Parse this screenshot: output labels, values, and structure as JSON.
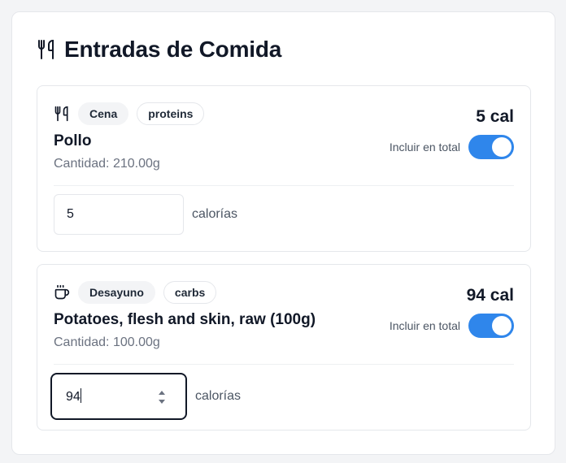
{
  "header": {
    "icon": "utensils-icon",
    "title": "Entradas de Comida"
  },
  "entries": [
    {
      "meal_icon": "utensils-icon",
      "meal": "Cena",
      "category": "proteins",
      "name": "Pollo",
      "quantity": "Cantidad: 210.00g",
      "calories_label": "5 cal",
      "include_label": "Incluir en total",
      "include_on": true,
      "calories_value": "5",
      "calories_unit": "calorías"
    },
    {
      "meal_icon": "coffee-cup-icon",
      "meal": "Desayuno",
      "category": "carbs",
      "name": "Potatoes, flesh and skin, raw (100g)",
      "quantity": "Cantidad: 100.00g",
      "calories_label": "94 cal",
      "include_label": "Incluir en total",
      "include_on": true,
      "calories_value": "94",
      "calories_unit": "calorías"
    }
  ],
  "colors": {
    "toggle_on": "#2f86eb",
    "chip_meal_bg": "#f3f4f6",
    "border": "#e5e7eb"
  }
}
